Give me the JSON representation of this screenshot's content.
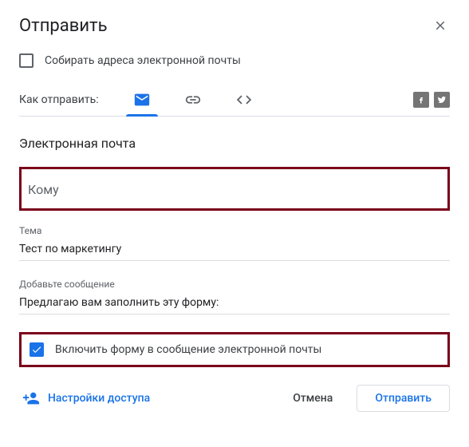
{
  "dialog": {
    "title": "Отправить",
    "collect_emails_label": "Собирать адреса электронной почты",
    "collect_emails_checked": false,
    "send_via_label": "Как отправить:",
    "section_title": "Электронная почта"
  },
  "tabs": {
    "email": "email-tab",
    "link": "link-tab",
    "embed": "embed-tab",
    "active": "email"
  },
  "fields": {
    "to_label": "Кому",
    "to_value": "",
    "subject_label": "Тема",
    "subject_value": "Тест по маркетингу",
    "message_label": "Добавьте сообщение",
    "message_value": "Предлагаю вам заполнить эту форму:"
  },
  "include": {
    "label": "Включить форму в сообщение электронной почты",
    "checked": true
  },
  "footer": {
    "access_label": "Настройки доступа",
    "cancel_label": "Отмена",
    "send_label": "Отправить"
  }
}
